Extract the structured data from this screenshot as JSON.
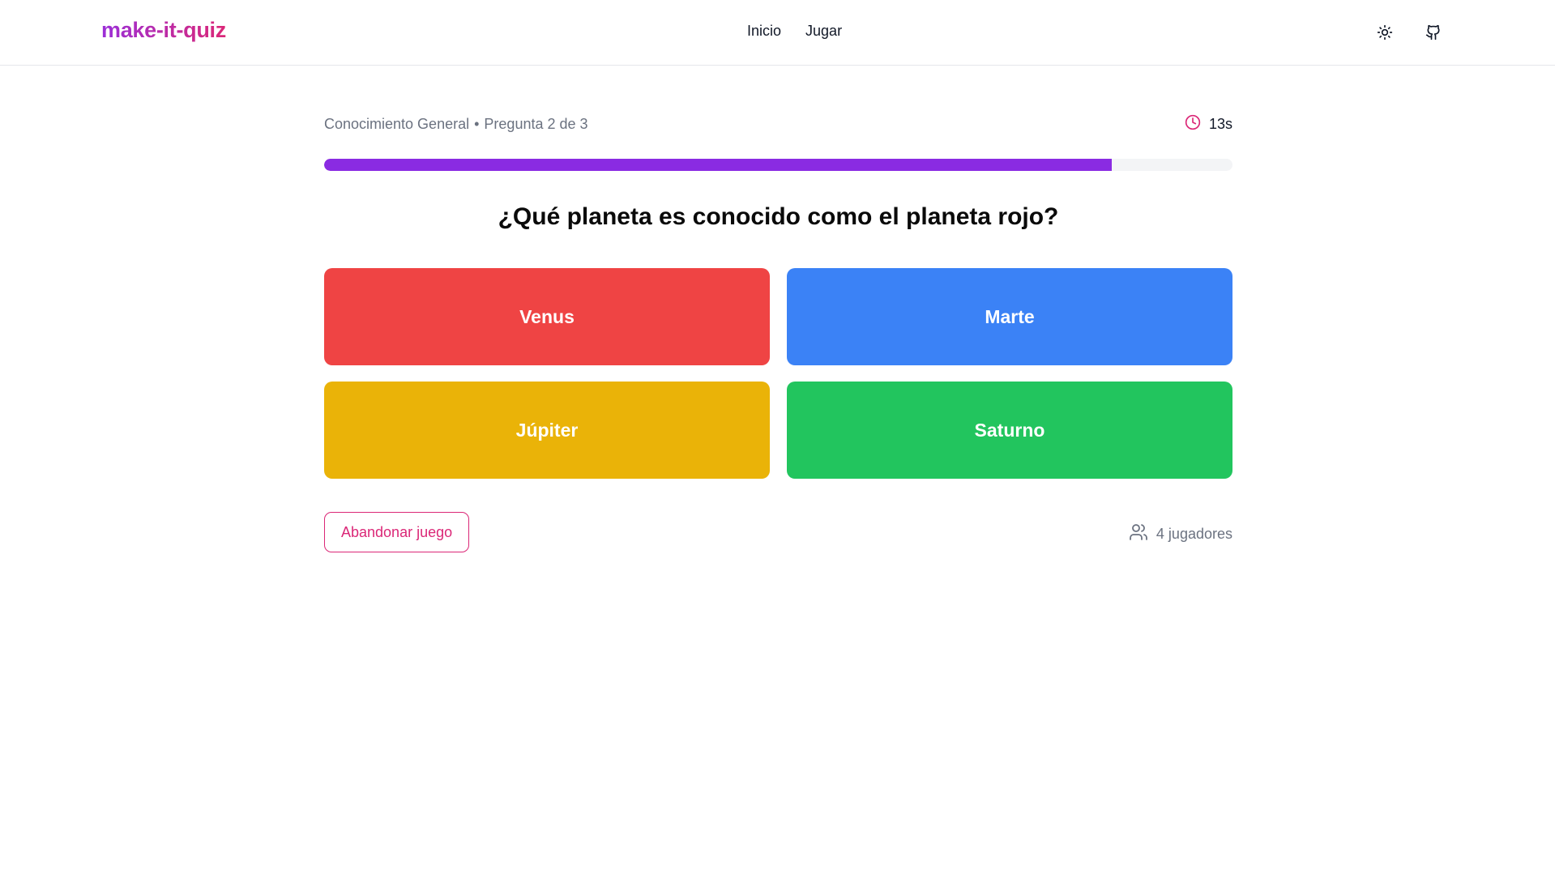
{
  "header": {
    "logo": "make-it-quiz",
    "nav": [
      {
        "label": "Inicio"
      },
      {
        "label": "Jugar"
      }
    ],
    "icons": [
      "sun-icon",
      "github-icon"
    ]
  },
  "game": {
    "category": "Conocimiento General",
    "separator": "•",
    "question_progress": "Pregunta 2 de 3",
    "timer": "13s",
    "timer_progress_percent": 86.7,
    "question": "¿Qué planeta es conocido como el planeta rojo?",
    "answers": [
      {
        "label": "Venus",
        "color": "#ef4444"
      },
      {
        "label": "Marte",
        "color": "#3b82f6"
      },
      {
        "label": "Júpiter",
        "color": "#eab308"
      },
      {
        "label": "Saturno",
        "color": "#22c55e"
      }
    ],
    "leave_button": "Abandonar juego",
    "players": "4 jugadores"
  },
  "colors": {
    "accent": "#8a2be2",
    "danger": "#db2777",
    "muted_text": "#6b7280"
  }
}
